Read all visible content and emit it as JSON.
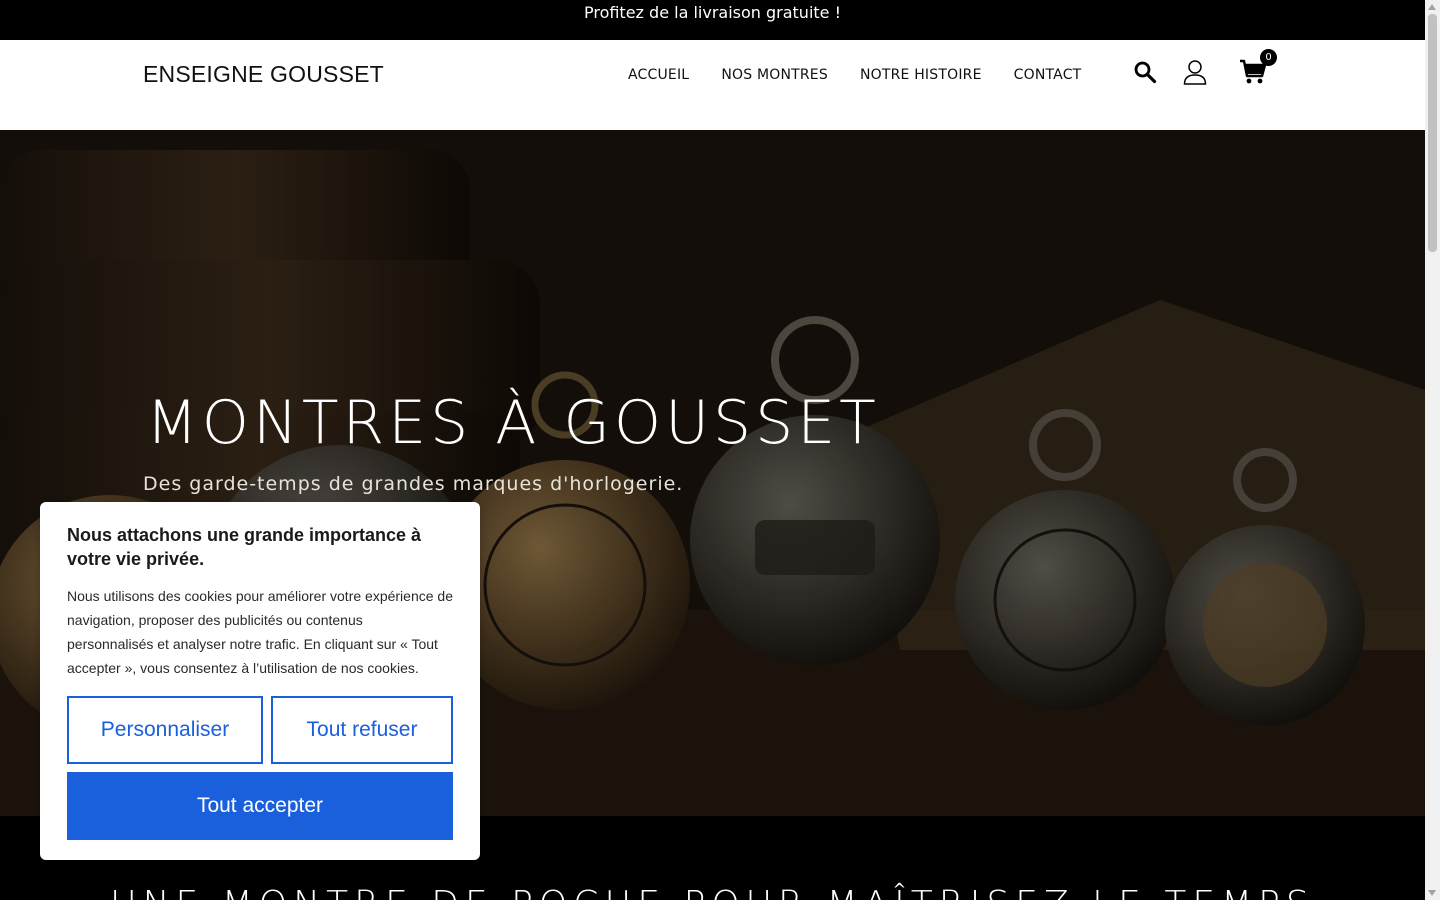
{
  "announcement": "Profitez de la livraison gratuite !",
  "header": {
    "logo": "ENSEIGNE GOUSSET",
    "nav": [
      "ACCUEIL",
      "NOS MONTRES",
      "NOTRE HISTOIRE",
      "CONTACT"
    ],
    "icons": [
      "search-icon",
      "user-icon",
      "cart-icon"
    ],
    "cart_count": "0"
  },
  "hero": {
    "title": "MONTRES À GOUSSET",
    "subtitle": "Des garde-temps de grandes marques d'horlogerie."
  },
  "section": {
    "title": "UNE MONTRE DE POCHE POUR MAÎTRISEZ LE TEMPS"
  },
  "cookie": {
    "title": "Nous attachons une grande importance à votre vie privée.",
    "text": "Nous utilisons des cookies pour améliorer votre expérience de navigation, proposer des publicités ou contenus personnalisés et analyser notre trafic. En cliquant sur « Tout accepter », vous consentez à l’utilisation de nos cookies.",
    "customize": "Personnaliser",
    "refuse": "Tout refuser",
    "accept": "Tout accepter"
  },
  "colors": {
    "primary": "#1a5fdc",
    "topbar": "#000000",
    "header": "#ffffff"
  }
}
